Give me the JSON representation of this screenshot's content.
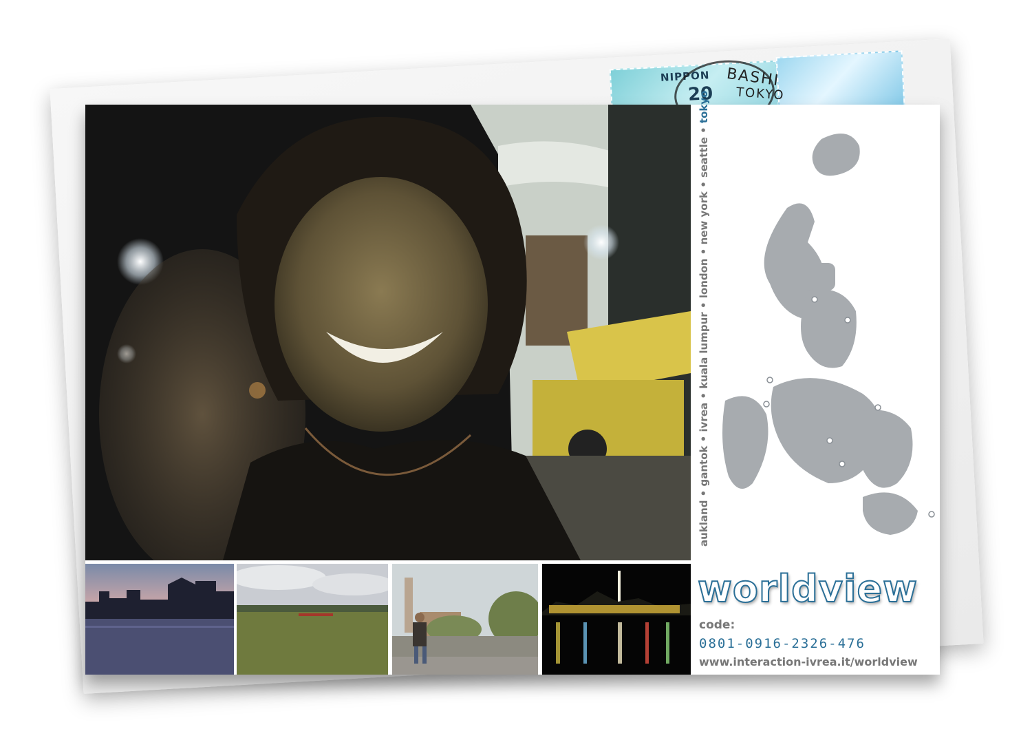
{
  "stamp": {
    "country": "NIPPON",
    "value": "20",
    "postmark_top": "BASHI",
    "postmark_bottom": "TOKYO"
  },
  "cities": {
    "list": "aukland • gantok • ivrea • kuala lumpur • london • new york • seattle •",
    "highlighted": "tokyo"
  },
  "brand": {
    "logo": "worldview",
    "code_label": "code:",
    "code_value": "0801-0916-2326-476",
    "url": "www.interaction-ivrea.it/worldview"
  },
  "colors": {
    "accent": "#2a6f97",
    "gray_text": "#777777",
    "map_fill": "#a7abaf"
  },
  "images": {
    "main": "webcam-photo-woman-smiling-tokyo-night",
    "thumb1": "city-skyline-at-dusk-over-water",
    "thumb2": "green-field-with-distant-city",
    "thumb3": "man-sitting-on-wall-old-town",
    "thumb4": "night-city-lights-reflected-in-harbor"
  }
}
